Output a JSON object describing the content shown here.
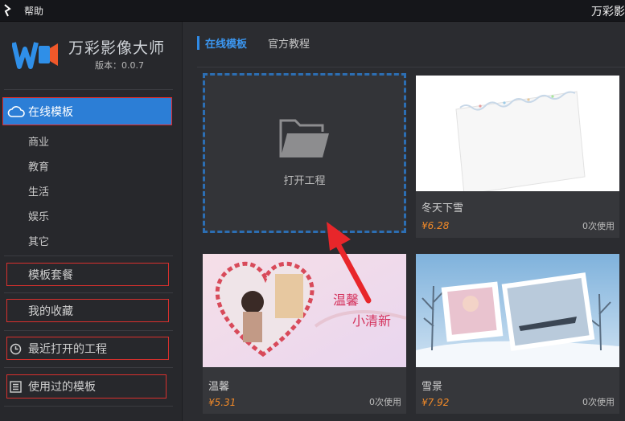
{
  "titlebar": {
    "menu_help": "帮助",
    "app_title": "万彩影"
  },
  "brand": {
    "name": "万彩影像大师",
    "version": "版本：0.0.7"
  },
  "sidebar": {
    "online_templates": "在线模板",
    "categories": [
      "商业",
      "教育",
      "生活",
      "娱乐",
      "其它"
    ],
    "template_packages": "模板套餐",
    "my_favorites": "我的收藏",
    "recent_projects": "最近打开的工程",
    "used_templates": "使用过的模板"
  },
  "tabs": {
    "active": "在线模板",
    "tutorial": "官方教程"
  },
  "open_project": {
    "label": "打开工程"
  },
  "templates": [
    {
      "name": "冬天下雪",
      "price": "¥6.28",
      "usage": "0次使用"
    },
    {
      "name": "温馨",
      "price": "¥5.31",
      "usage": "0次使用",
      "overlay_1": "温馨",
      "overlay_2": "小清新"
    },
    {
      "name": "雪景",
      "price": "¥7.92",
      "usage": "0次使用"
    }
  ],
  "colors": {
    "accent": "#2c7ed6",
    "price": "#f28a28",
    "highlight_border": "#e02a2a"
  }
}
